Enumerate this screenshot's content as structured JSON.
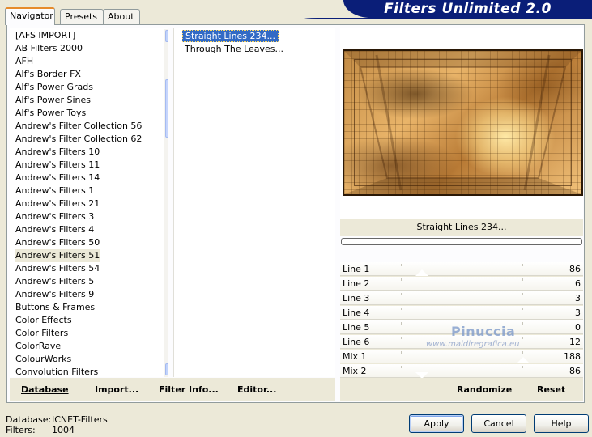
{
  "title": "Filters Unlimited 2.0",
  "tabs": [
    {
      "label": "Navigator",
      "active": true
    },
    {
      "label": "Presets",
      "active": false
    },
    {
      "label": "About",
      "active": false
    }
  ],
  "categories": [
    "[AFS IMPORT]",
    "AB Filters 2000",
    "AFH",
    "Alf's Border FX",
    "Alf's Power Grads",
    "Alf's Power Sines",
    "Alf's Power Toys",
    "Andrew's Filter Collection 56",
    "Andrew's Filter Collection 62",
    "Andrew's Filters 10",
    "Andrew's Filters 11",
    "Andrew's Filters 14",
    "Andrew's Filters 1",
    "Andrew's Filters 21",
    "Andrew's Filters 3",
    "Andrew's Filters 4",
    "Andrew's Filters 50",
    "Andrew's Filters 51",
    "Andrew's Filters 54",
    "Andrew's Filters 5",
    "Andrew's Filters 9",
    "Buttons & Frames",
    "Color Effects",
    "Color Filters",
    "ColorRave",
    "ColourWorks",
    "Convolution Filters"
  ],
  "selected_category": "Andrew's Filters 51",
  "filters": [
    "Straight Lines 234...",
    "Through The Leaves..."
  ],
  "selected_filter": "Straight Lines 234...",
  "left_buttons": {
    "database": "Database",
    "import": "Import...",
    "filter_info": "Filter Info...",
    "editor": "Editor..."
  },
  "preview_filter_name": "Straight Lines 234...",
  "progress": 0,
  "sliders": [
    {
      "name": "Line 1",
      "value": "86"
    },
    {
      "name": "Line 2",
      "value": "6"
    },
    {
      "name": "Line 3",
      "value": "3"
    },
    {
      "name": "Line 4",
      "value": "3"
    },
    {
      "name": "Line 5",
      "value": "0"
    },
    {
      "name": "Line 6",
      "value": "12"
    },
    {
      "name": "Mix 1",
      "value": "188"
    },
    {
      "name": "Mix 2",
      "value": "86"
    }
  ],
  "right_buttons": {
    "randomize": "Randomize",
    "reset": "Reset"
  },
  "watermark": {
    "name": "Pinuccia",
    "site": "www.maidiregrafica.eu"
  },
  "status": {
    "database_label": "Database:",
    "database_value": "ICNET-Filters",
    "filters_label": "Filters:",
    "filters_value": "1004"
  },
  "dialog_buttons": {
    "apply": "Apply",
    "cancel": "Cancel",
    "help": "Help"
  },
  "scroll_arrows": {
    "up": "▲",
    "down": "▼"
  },
  "colors": {
    "banner": "#0a1e78",
    "selection": "#316ac5",
    "face": "#ece9d8"
  }
}
